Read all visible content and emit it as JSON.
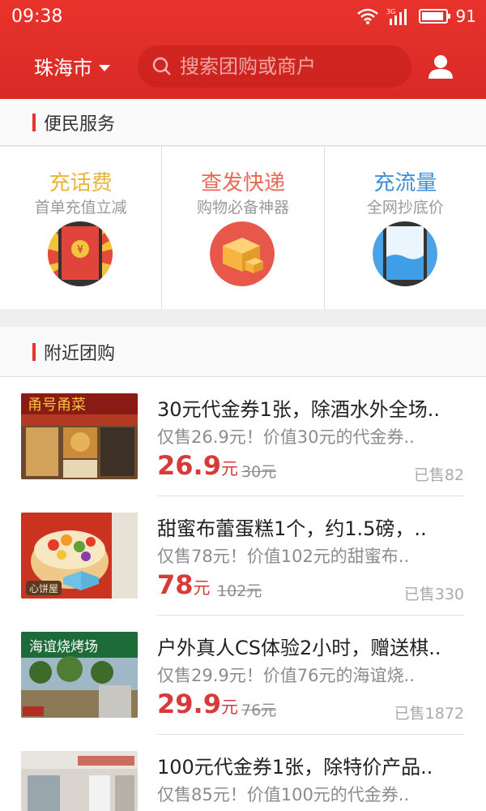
{
  "status": {
    "time": "09:38",
    "network": "3G",
    "battery": "91"
  },
  "header": {
    "city": "珠海市",
    "search_placeholder": "搜索团购或商户"
  },
  "sections": {
    "services_title": "便民服务",
    "nearby_title": "附近团购"
  },
  "services": [
    {
      "title": "充话费",
      "subtitle": "首单充值立减",
      "title_color": "#e8b53a",
      "icon": "phone-redpacket-icon"
    },
    {
      "title": "查发快递",
      "subtitle": "购物必备神器",
      "title_color": "#e66a55",
      "icon": "package-icon"
    },
    {
      "title": "充流量",
      "subtitle": "全网抄底价",
      "title_color": "#3d8fd6",
      "icon": "phone-water-icon"
    }
  ],
  "deals": [
    {
      "title": "30元代金券1张，除酒水外全场..",
      "desc": "仅售26.9元！价值30元的代金券..",
      "price": "26.9",
      "unit": "元",
      "original": "30元",
      "sold": "已售82"
    },
    {
      "title": "甜蜜布蕾蛋糕1个，约1.5磅，..",
      "desc": "仅售78元！价值102元的甜蜜布..",
      "price": "78",
      "unit": "元",
      "original": "102元",
      "sold": "已售330"
    },
    {
      "title": "户外真人CS体验2小时，赠送棋..",
      "desc": "仅售29.9元！价值76元的海谊烧..",
      "price": "29.9",
      "unit": "元",
      "original": "76元",
      "sold": "已售1872"
    },
    {
      "title": "100元代金券1张，除特价产品..",
      "desc": "仅售85元！价值100元的代金券..",
      "price": "",
      "unit": "",
      "original": "",
      "sold": ""
    }
  ],
  "thumb_signs": {
    "restaurant_sign": "甬号甬菜",
    "bakery_logo": "心饼屋",
    "bbq_sign": "海谊烧烤场"
  },
  "colors": {
    "brand_red": "#e8332c",
    "price_red": "#d83a3a"
  }
}
